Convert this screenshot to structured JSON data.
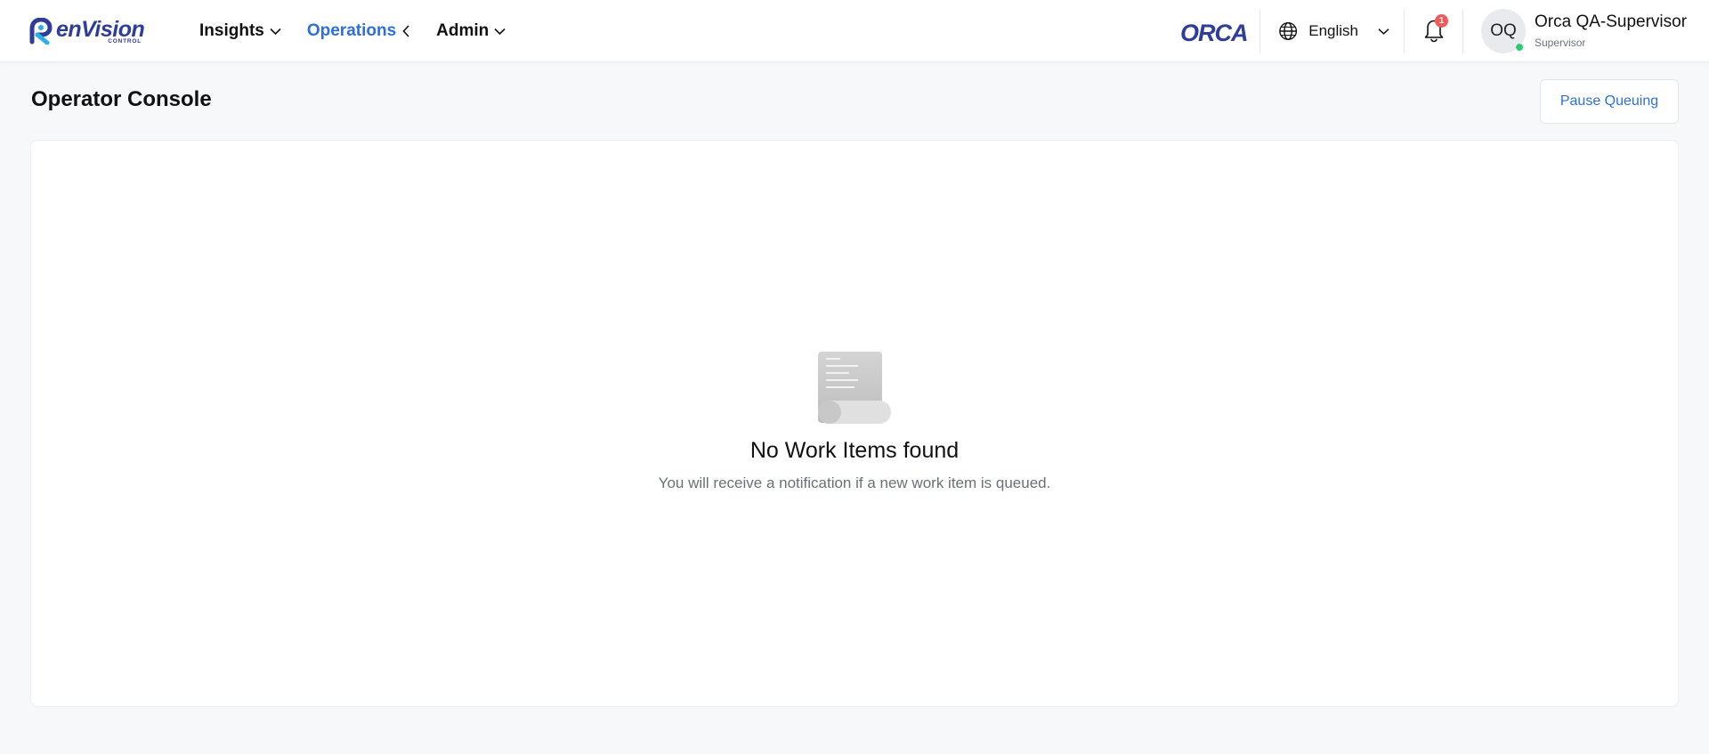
{
  "brand": {
    "name": "enVision",
    "sub": "CONTROL"
  },
  "nav": {
    "items": [
      {
        "label": "Insights",
        "active": false
      },
      {
        "label": "Operations",
        "active": true
      },
      {
        "label": "Admin",
        "active": false
      }
    ]
  },
  "header": {
    "product_logo": "ORCA",
    "language": "English",
    "notification_count": "1",
    "user": {
      "initials": "OQ",
      "name": "Orca QA-Supervisor",
      "role": "Supervisor",
      "status": "online"
    }
  },
  "page": {
    "title": "Operator Console",
    "pause_button": "Pause Queuing"
  },
  "empty_state": {
    "title": "No Work Items found",
    "subtitle": "You will receive a notification if a new work item is queued.",
    "icon": "scroll-document-icon"
  },
  "colors": {
    "accent": "#2d6fdb",
    "brand": "#2e3c9a",
    "badge": "#ef5b5b",
    "online": "#2ecc71",
    "background": "#f7f8fa"
  }
}
